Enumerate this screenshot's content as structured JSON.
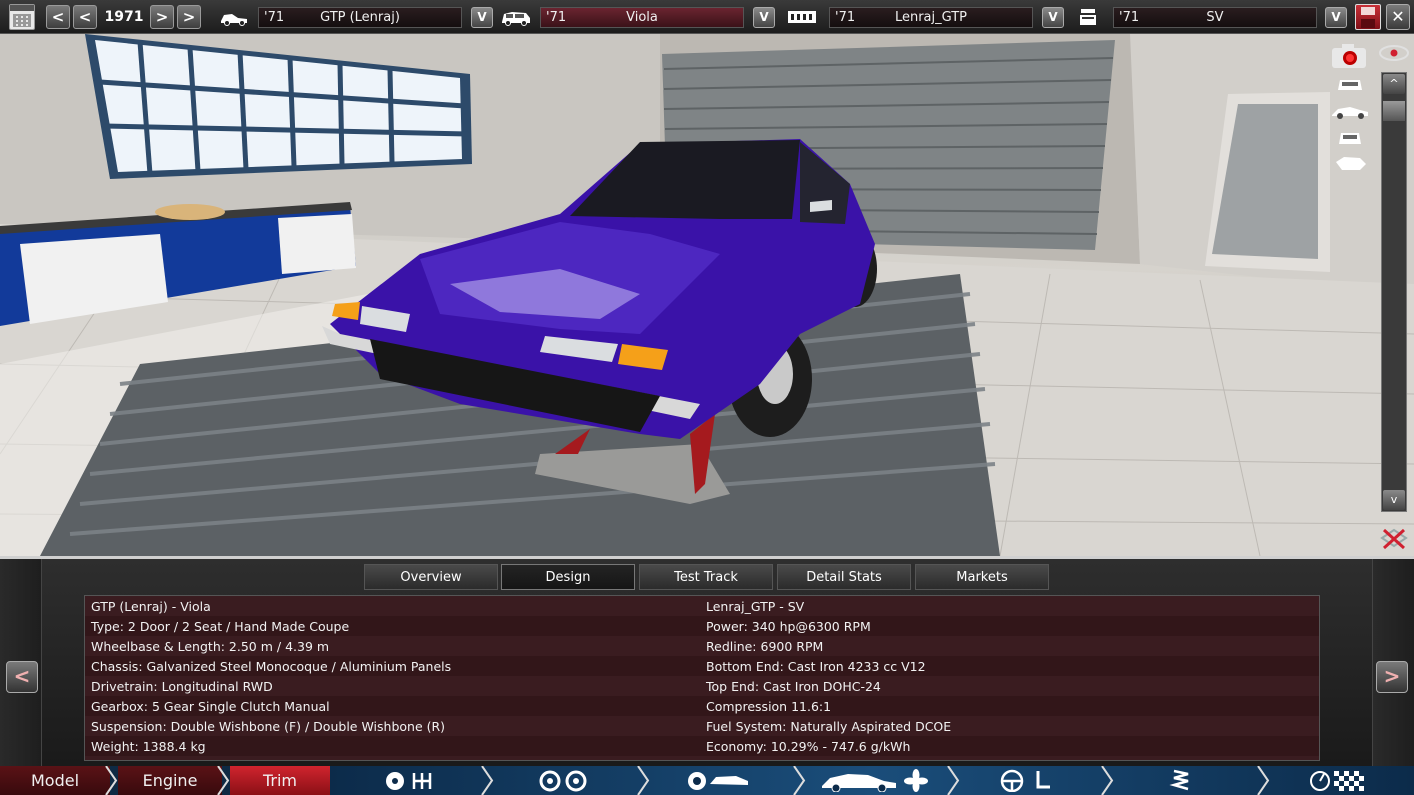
{
  "topbar": {
    "year": "1971",
    "prev2": "<",
    "prev1": "<",
    "next1": ">",
    "next2": ">",
    "v": "V",
    "model": {
      "year": "'71",
      "name": "GTP (Lenraj)"
    },
    "trim": {
      "year": "'71",
      "name": "Viola"
    },
    "engine_family": {
      "year": "'71",
      "name": "Lenraj_GTP"
    },
    "engine_variant": {
      "year": "'71",
      "name": "SV"
    }
  },
  "panel": {
    "tabs": [
      "Overview",
      "Design",
      "Test Track",
      "Detail Stats",
      "Markets"
    ],
    "active_tab": "Design",
    "left": [
      "GTP (Lenraj) - Viola",
      "Type: 2 Door / 2 Seat / Hand Made Coupe",
      "Wheelbase & Length: 2.50 m / 4.39 m",
      "Chassis: Galvanized Steel Monocoque / Aluminium Panels",
      "Drivetrain: Longitudinal RWD",
      "Gearbox: 5 Gear Single Clutch Manual",
      "Suspension: Double Wishbone (F) / Double Wishbone (R)",
      "Weight: 1388.4 kg"
    ],
    "right": [
      "Lenraj_GTP - SV",
      "Power: 340 hp@6300 RPM",
      "Redline: 6900 RPM",
      "Bottom End: Cast Iron 4233 cc V12",
      "Top End: Cast Iron DOHC-24",
      "Compression 11.6:1",
      "Fuel System: Naturally Aspirated DCOE",
      "Economy: 10.29% - 747.6 g/kWh"
    ],
    "prev": "<",
    "next": ">"
  },
  "bottombar": {
    "sections": [
      "Model",
      "Engine",
      "Trim"
    ],
    "active_section": "Trim"
  },
  "colors": {
    "car_body": "#3a12a8",
    "accent_red": "#b8161e",
    "bottom_bar": "#0e2a44"
  }
}
